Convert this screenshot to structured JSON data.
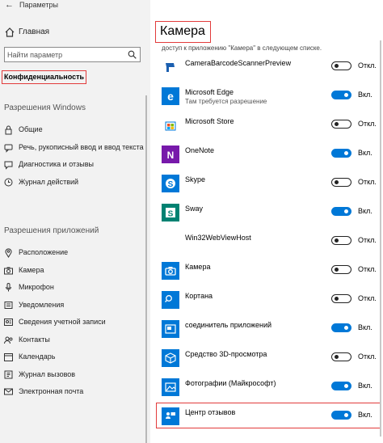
{
  "window": {
    "title": "Параметры",
    "back_glyph": "←"
  },
  "nav": {
    "home_label": "Главная",
    "search_placeholder": "Найти параметр",
    "active_section": "Конфиденциальность",
    "group_windows": "Разрешения Windows",
    "windows_items": [
      {
        "label": "Общие",
        "icon": "lock-icon"
      },
      {
        "label": "Речь, рукописный ввод и ввод текста",
        "icon": "speech-icon"
      },
      {
        "label": "Диагностика и отзывы",
        "icon": "feedback-icon"
      },
      {
        "label": "Журнал действий",
        "icon": "activity-icon"
      }
    ],
    "group_apps": "Разрешения приложений",
    "apps_items": [
      {
        "label": "Расположение",
        "icon": "location-icon"
      },
      {
        "label": "Камера",
        "icon": "camera-icon"
      },
      {
        "label": "Микрофон",
        "icon": "microphone-icon"
      },
      {
        "label": "Уведомления",
        "icon": "notifications-icon"
      },
      {
        "label": "Сведения учетной записи",
        "icon": "account-info-icon"
      },
      {
        "label": "Контакты",
        "icon": "contacts-icon"
      },
      {
        "label": "Календарь",
        "icon": "calendar-icon"
      },
      {
        "label": "Журнал вызовов",
        "icon": "call-history-icon"
      },
      {
        "label": "Электронная почта",
        "icon": "email-icon"
      }
    ]
  },
  "main": {
    "title": "Камера",
    "subtitle": "доступ к приложению \"Камера\" в следующем списке.",
    "apps": [
      {
        "name": "CameraBarcodeScannerPreview",
        "sub": "",
        "on": false,
        "state": "Откл.",
        "icon": "barcode-scanner-icon",
        "tile": "#ffffff"
      },
      {
        "name": "Microsoft Edge",
        "sub": "Там требуется разрешение",
        "on": true,
        "state": "Вкл.",
        "icon": "edge-icon",
        "tile": "#0078d7"
      },
      {
        "name": "Microsoft Store",
        "sub": "",
        "on": false,
        "state": "Откл.",
        "icon": "store-icon",
        "tile": "#ffffff"
      },
      {
        "name": "OneNote",
        "sub": "",
        "on": true,
        "state": "Вкл.",
        "icon": "onenote-icon",
        "tile": "#7719aa"
      },
      {
        "name": "Skype",
        "sub": "",
        "on": false,
        "state": "Откл.",
        "icon": "skype-icon",
        "tile": "#0078d7"
      },
      {
        "name": "Sway",
        "sub": "",
        "on": true,
        "state": "Вкл.",
        "icon": "sway-icon",
        "tile": "#008272"
      },
      {
        "name": "Win32WebViewHost",
        "sub": "",
        "on": false,
        "state": "Откл.",
        "icon": "webview-icon",
        "tile": "#ffffff"
      },
      {
        "name": "Камера",
        "sub": "",
        "on": false,
        "state": "Откл.",
        "icon": "camera-app-icon",
        "tile": "#0078d7"
      },
      {
        "name": "Кортана",
        "sub": "",
        "on": false,
        "state": "Откл.",
        "icon": "cortana-icon",
        "tile": "#0078d7"
      },
      {
        "name": "соединитель приложений",
        "sub": "",
        "on": true,
        "state": "Вкл.",
        "icon": "app-connector-icon",
        "tile": "#0078d7"
      },
      {
        "name": "Средство 3D-просмотра",
        "sub": "",
        "on": false,
        "state": "Откл.",
        "icon": "3d-viewer-icon",
        "tile": "#0078d7"
      },
      {
        "name": "Фотографии (Майкрософт)",
        "sub": "",
        "on": true,
        "state": "Вкл.",
        "icon": "photos-icon",
        "tile": "#0078d7"
      },
      {
        "name": "Центр отзывов",
        "sub": "",
        "on": true,
        "state": "Вкл.",
        "icon": "feedback-hub-icon",
        "tile": "#0078d7"
      }
    ]
  },
  "colors": {
    "accent": "#0078d7",
    "highlight": "#e23b3b",
    "nav_bg": "#f2f2f2"
  }
}
